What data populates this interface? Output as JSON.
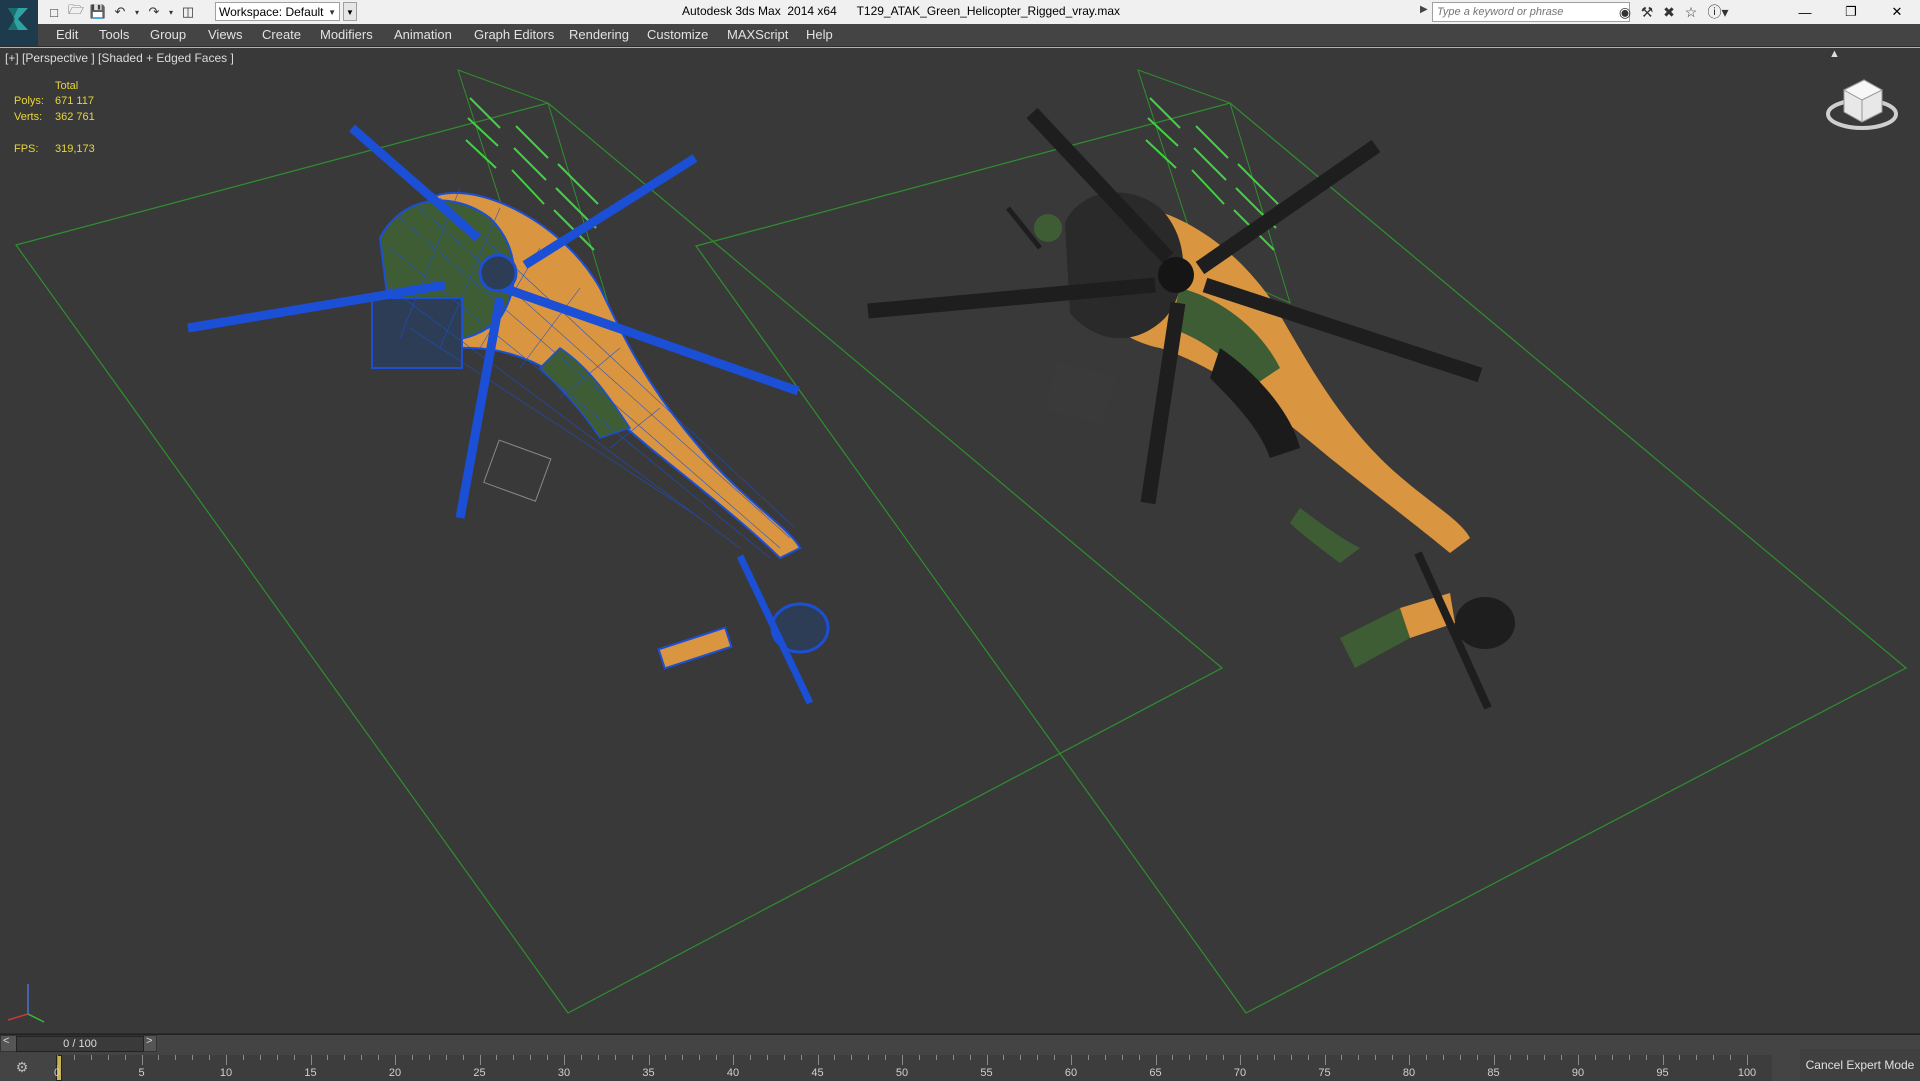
{
  "title_bar": {
    "app_title": "Autodesk 3ds Max  2014 x64",
    "file_name": "T129_ATAK_Green_Helicopter_Rigged_vray.max",
    "workspace_label": "Workspace: Default",
    "search_placeholder": "Type a keyword or phrase",
    "quick_access_icons": [
      "new-file-icon",
      "open-file-icon",
      "save-icon",
      "undo-icon",
      "redo-icon",
      "project-folder-icon"
    ],
    "tool_icons": [
      "binoculars-icon",
      "subscription-icon",
      "exchange-icon",
      "favorites-star-icon",
      "help-icon"
    ],
    "window_controls": [
      "minimize-icon",
      "restore-icon",
      "close-icon"
    ]
  },
  "menu": {
    "items": [
      "Edit",
      "Tools",
      "Group",
      "Views",
      "Create",
      "Modifiers",
      "Animation",
      "Graph Editors",
      "Rendering",
      "Customize",
      "MAXScript",
      "Help"
    ]
  },
  "viewport": {
    "label": "[+] [Perspective ] [Shaded + Edged Faces ]",
    "stats": {
      "header": "Total",
      "polys_label": "Polys:",
      "polys_value": "671 117",
      "verts_label": "Verts:",
      "verts_value": "362 761",
      "fps_label": "FPS:",
      "fps_value": "319,173"
    },
    "colors": {
      "background": "#393939",
      "grid_green": "#2f8f2f",
      "wire_blue": "#1a4fd6",
      "camo_tan": "#d9953f",
      "camo_green": "#3f5d35",
      "stats_yellow": "#e7d63a"
    }
  },
  "timeline": {
    "slider_label": "0 / 100",
    "left_arrow": "<",
    "right_arrow": ">",
    "ticks": [
      "0",
      "5",
      "10",
      "15",
      "20",
      "25",
      "30",
      "35",
      "40",
      "45",
      "50",
      "55",
      "60",
      "65",
      "70",
      "75",
      "80",
      "85",
      "90",
      "95",
      "100"
    ],
    "cancel_expert_label": "Cancel Expert Mode"
  }
}
